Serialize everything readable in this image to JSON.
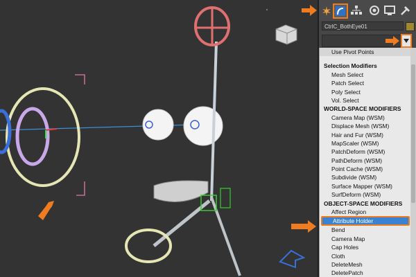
{
  "command_panel": {
    "tabs": [
      {
        "name": "create",
        "icon": "star-burst-icon"
      },
      {
        "name": "modify",
        "icon": "modify-bend-icon",
        "active": true
      },
      {
        "name": "hierarchy",
        "icon": "hierarchy-icon"
      },
      {
        "name": "motion",
        "icon": "motion-icon"
      },
      {
        "name": "display",
        "icon": "display-monitor-icon"
      },
      {
        "name": "utilities",
        "icon": "hammer-icon"
      }
    ],
    "object_name": "CtrlC_BothEye01",
    "object_color": "#a0882e",
    "modifier_list": {
      "value": "",
      "items": [
        {
          "label": "Use Pivot Points",
          "type": "item"
        },
        {
          "label": "Selection Modifiers",
          "type": "header"
        },
        {
          "label": "Mesh Select",
          "type": "item"
        },
        {
          "label": "Patch Select",
          "type": "item"
        },
        {
          "label": "Poly Select",
          "type": "item"
        },
        {
          "label": "Vol. Select",
          "type": "item"
        },
        {
          "label": "WORLD-SPACE MODIFIERS",
          "type": "header"
        },
        {
          "label": "Camera Map (WSM)",
          "type": "item"
        },
        {
          "label": "Displace Mesh (WSM)",
          "type": "item"
        },
        {
          "label": "Hair and Fur (WSM)",
          "type": "item"
        },
        {
          "label": "MapScaler (WSM)",
          "type": "item"
        },
        {
          "label": "PatchDeform (WSM)",
          "type": "item"
        },
        {
          "label": "PathDeform (WSM)",
          "type": "item"
        },
        {
          "label": "Point Cache (WSM)",
          "type": "item"
        },
        {
          "label": "Subdivide (WSM)",
          "type": "item"
        },
        {
          "label": "Surface Mapper (WSM)",
          "type": "item"
        },
        {
          "label": "SurfDeform (WSM)",
          "type": "item"
        },
        {
          "label": "OBJECT-SPACE MODIFIERS",
          "type": "header"
        },
        {
          "label": "Affect Region",
          "type": "item"
        },
        {
          "label": "Attribute Holder",
          "type": "item",
          "selected": true
        },
        {
          "label": "Bend",
          "type": "item"
        },
        {
          "label": "Camera Map",
          "type": "item"
        },
        {
          "label": "Cap Holes",
          "type": "item"
        },
        {
          "label": "Cloth",
          "type": "item"
        },
        {
          "label": "DeleteMesh",
          "type": "item"
        },
        {
          "label": "DeletePatch",
          "type": "item"
        }
      ]
    }
  },
  "colors": {
    "highlight_arrow": "#f07c22",
    "selection": "#3a82d2",
    "viewport_bg": "#333333"
  }
}
